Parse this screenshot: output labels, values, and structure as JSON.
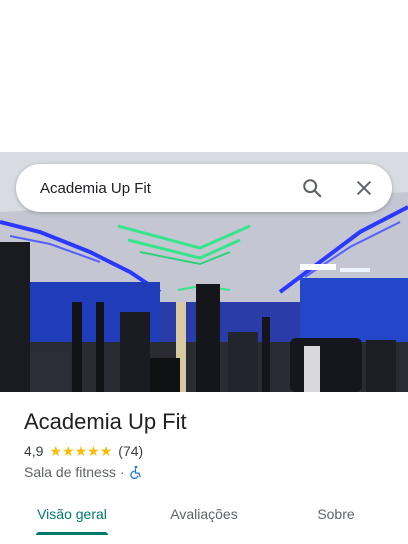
{
  "search": {
    "query": "Academia Up Fit"
  },
  "place": {
    "name": "Academia Up Fit",
    "rating": "4,9",
    "review_count": "(74)",
    "stars": 5,
    "category": "Sala de fitness",
    "separator": "·"
  },
  "tabs": [
    {
      "label": "Visão geral",
      "active": true
    },
    {
      "label": "Avaliações",
      "active": false
    },
    {
      "label": "Sobre",
      "active": false
    }
  ],
  "icons": {
    "search": "search-icon",
    "close": "close-icon",
    "star": "star-icon",
    "accessibility": "wheelchair-icon"
  },
  "colors": {
    "accent": "#00796b",
    "star": "#fbbc04",
    "accessibility": "#1a73e8"
  }
}
